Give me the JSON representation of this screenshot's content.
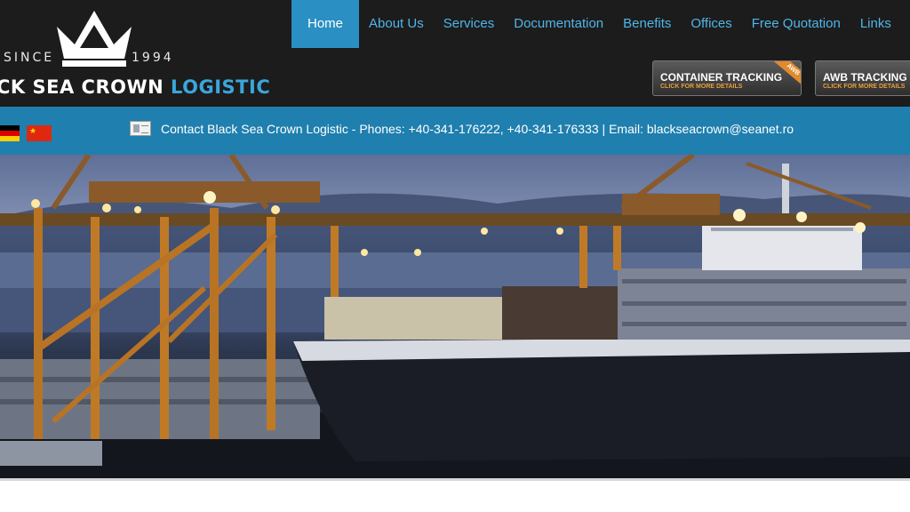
{
  "logo": {
    "since": "SINCE",
    "year": "1994",
    "name_white": "CK SEA CROWN",
    "name_blue": "LOGISTIC"
  },
  "nav": {
    "items": [
      "Home",
      "About Us",
      "Services",
      "Documentation",
      "Benefits",
      "Offices",
      "Free Quotation",
      "Links"
    ],
    "active": "Home"
  },
  "tracking": {
    "container": {
      "title": "CONTAINER TRACKING",
      "sub": "CLICK FOR MORE DETAILS",
      "ribbon": "AWB"
    },
    "awb": {
      "title": "AWB TRACKING",
      "sub": "CLICK FOR MORE DETAILS"
    }
  },
  "contact": {
    "text": "Contact Black Sea Crown Logistic - Phones: +40-341-176222, +40-341-176333 | Email: blackseacrown@seanet.ro"
  },
  "colors": {
    "header_bg": "#1c1c1c",
    "nav_text": "#4fb6ea",
    "nav_active_bg": "#2a8fc2",
    "contact_bar": "#1f7fae",
    "brand_blue": "#3aa6dc"
  }
}
